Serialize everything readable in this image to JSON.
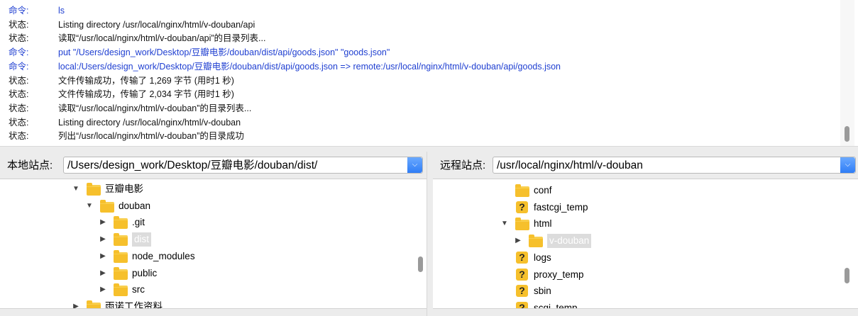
{
  "log": {
    "messages": [
      {
        "kind": "cmd",
        "label": "命令:",
        "text": "ls"
      },
      {
        "kind": "status",
        "label": "状态:",
        "text": "Listing directory /usr/local/nginx/html/v-douban/api"
      },
      {
        "kind": "status",
        "label": "状态:",
        "text": "读取“/usr/local/nginx/html/v-douban/api”的目录列表..."
      },
      {
        "kind": "cmd",
        "label": "命令:",
        "text": "put \"/Users/design_work/Desktop/豆瓣电影/douban/dist/api/goods.json\" \"goods.json\""
      },
      {
        "kind": "cmd",
        "label": "命令:",
        "text": "local:/Users/design_work/Desktop/豆瓣电影/douban/dist/api/goods.json => remote:/usr/local/nginx/html/v-douban/api/goods.json"
      },
      {
        "kind": "status",
        "label": "状态:",
        "text": "文件传输成功，传输了 1,269 字节 (用时1 秒)"
      },
      {
        "kind": "status",
        "label": "状态:",
        "text": "文件传输成功，传输了 2,034 字节 (用时1 秒)"
      },
      {
        "kind": "status",
        "label": "状态:",
        "text": "读取“/usr/local/nginx/html/v-douban”的目录列表..."
      },
      {
        "kind": "status",
        "label": "状态:",
        "text": "Listing directory /usr/local/nginx/html/v-douban"
      },
      {
        "kind": "status",
        "label": "状态:",
        "text": "列出“/usr/local/nginx/html/v-douban”的目录成功"
      }
    ],
    "colors": {
      "command": "#1f3fd1",
      "status": "#111111"
    }
  },
  "local": {
    "site_label": "本地站点:",
    "path": "/Users/design_work/Desktop/豆瓣电影/douban/dist/",
    "tree": [
      {
        "label": "豆瓣电影",
        "icon": "folder-icon",
        "expand": "expanded",
        "depth": 0
      },
      {
        "label": "douban",
        "icon": "folder-icon",
        "expand": "expanded",
        "depth": 1
      },
      {
        "label": ".git",
        "icon": "folder-icon",
        "expand": "collapsed",
        "depth": 2
      },
      {
        "label": "dist",
        "icon": "folder-icon",
        "expand": "collapsed",
        "depth": 2,
        "selected": true
      },
      {
        "label": "node_modules",
        "icon": "folder-icon",
        "expand": "collapsed",
        "depth": 2
      },
      {
        "label": "public",
        "icon": "folder-icon",
        "expand": "collapsed",
        "depth": 2
      },
      {
        "label": "src",
        "icon": "folder-icon",
        "expand": "collapsed",
        "depth": 2
      },
      {
        "label": "雨诺工作资料",
        "icon": "folder-icon",
        "expand": "collapsed",
        "depth": 0
      }
    ]
  },
  "remote": {
    "site_label": "远程站点:",
    "path": "/usr/local/nginx/html/v-douban",
    "tree": [
      {
        "label": "conf",
        "icon": "folder-icon",
        "expand": "none",
        "depth": 1
      },
      {
        "label": "fastcgi_temp",
        "icon": "unknown-folder-icon",
        "expand": "none",
        "depth": 1
      },
      {
        "label": "html",
        "icon": "folder-icon",
        "expand": "expanded",
        "depth": 1
      },
      {
        "label": "v-douban",
        "icon": "folder-icon",
        "expand": "collapsed",
        "depth": 2,
        "selected": true
      },
      {
        "label": "logs",
        "icon": "unknown-folder-icon",
        "expand": "none",
        "depth": 1
      },
      {
        "label": "proxy_temp",
        "icon": "unknown-folder-icon",
        "expand": "none",
        "depth": 1
      },
      {
        "label": "sbin",
        "icon": "unknown-folder-icon",
        "expand": "none",
        "depth": 1
      },
      {
        "label": "scgi_temp",
        "icon": "unknown-folder-icon",
        "expand": "none",
        "depth": 1
      }
    ]
  },
  "icons": {
    "expanded": "▼",
    "collapsed": "▶",
    "unknown_glyph": "?",
    "dropdown": "chevron-down-icon"
  }
}
